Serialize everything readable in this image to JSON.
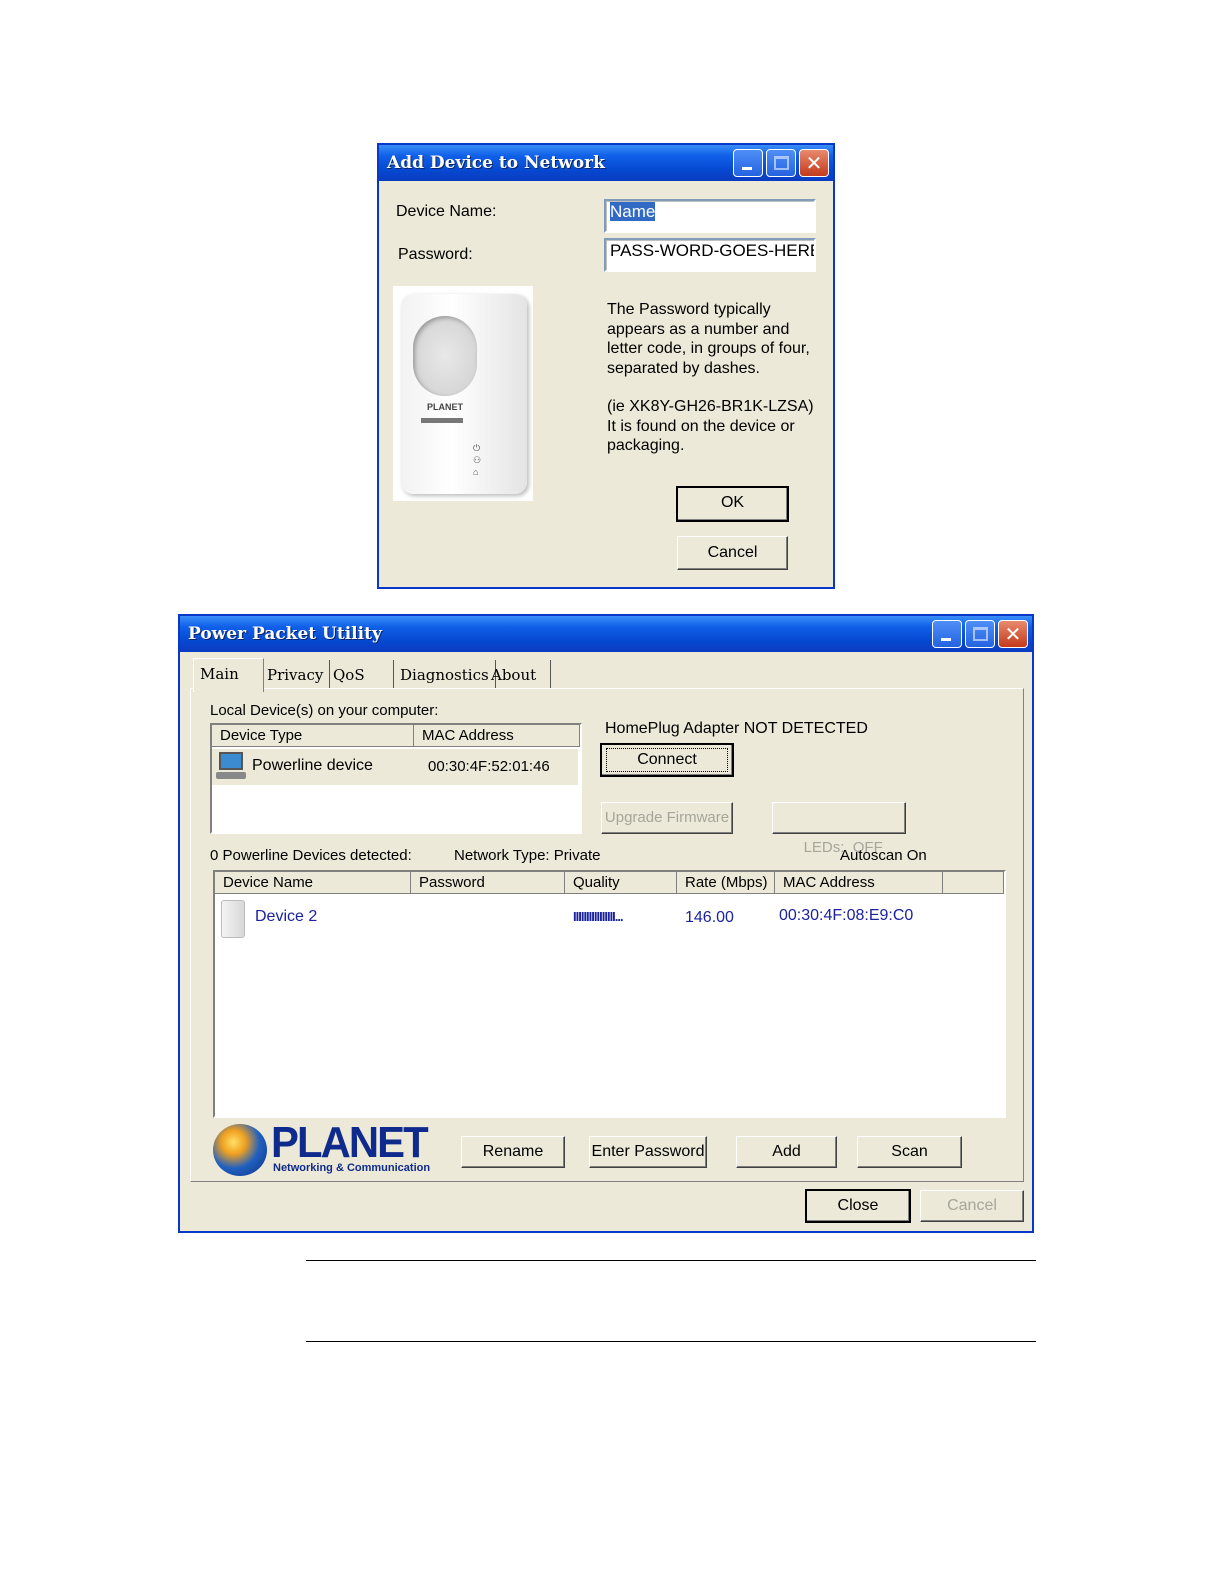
{
  "dialog": {
    "title": "Add Device to Network",
    "device_name_label": "Device Name:",
    "device_name_value": "Name",
    "password_label": "Password:",
    "password_value": "PASS-WORD-GOES-HERE",
    "help_text_1": "The Password typically appears as a number and letter code, in groups of four, separated by dashes.",
    "help_text_2": "(ie XK8Y-GH26-BR1K-LZSA) It is found on the device or packaging.",
    "ok_label": "OK",
    "cancel_label": "Cancel",
    "device_photo_brand": "PLANET"
  },
  "utility": {
    "title": "Power Packet Utility",
    "tabs": [
      {
        "label": "Main"
      },
      {
        "label": "Privacy"
      },
      {
        "label": "QoS"
      },
      {
        "label": "Diagnostics"
      },
      {
        "label": "About"
      }
    ],
    "local_devices_label": "Local Device(s) on your computer:",
    "local_columns": [
      "Device Type",
      "MAC Address"
    ],
    "local_rows": [
      {
        "device_type": "Powerline device",
        "mac": "00:30:4F:52:01:46"
      }
    ],
    "adapter_status": "HomePlug Adapter NOT DETECTED",
    "connect_label": "Connect",
    "upgrade_label": "Upgrade Firmware",
    "leds_label": "LEDs:  OFF",
    "devices_detected": "0 Powerline Devices detected:",
    "network_type": "Network Type: Private",
    "autoscan": "Autoscan On",
    "remote_columns": [
      "Device Name",
      "Password",
      "Quality",
      "Rate (Mbps)",
      "MAC Address"
    ],
    "remote_rows": [
      {
        "device_name": "Device 2",
        "password": "",
        "quality": "IIIIIIIIIIIIIIII...",
        "rate": "146.00",
        "mac": "00:30:4F:08:E9:C0"
      }
    ],
    "logo_text": "PLANET",
    "logo_subtext": "Networking & Communication",
    "rename_label": "Rename",
    "enter_password_label": "Enter Password",
    "add_label": "Add",
    "scan_label": "Scan",
    "close_label": "Close",
    "cancel_label": "Cancel"
  }
}
